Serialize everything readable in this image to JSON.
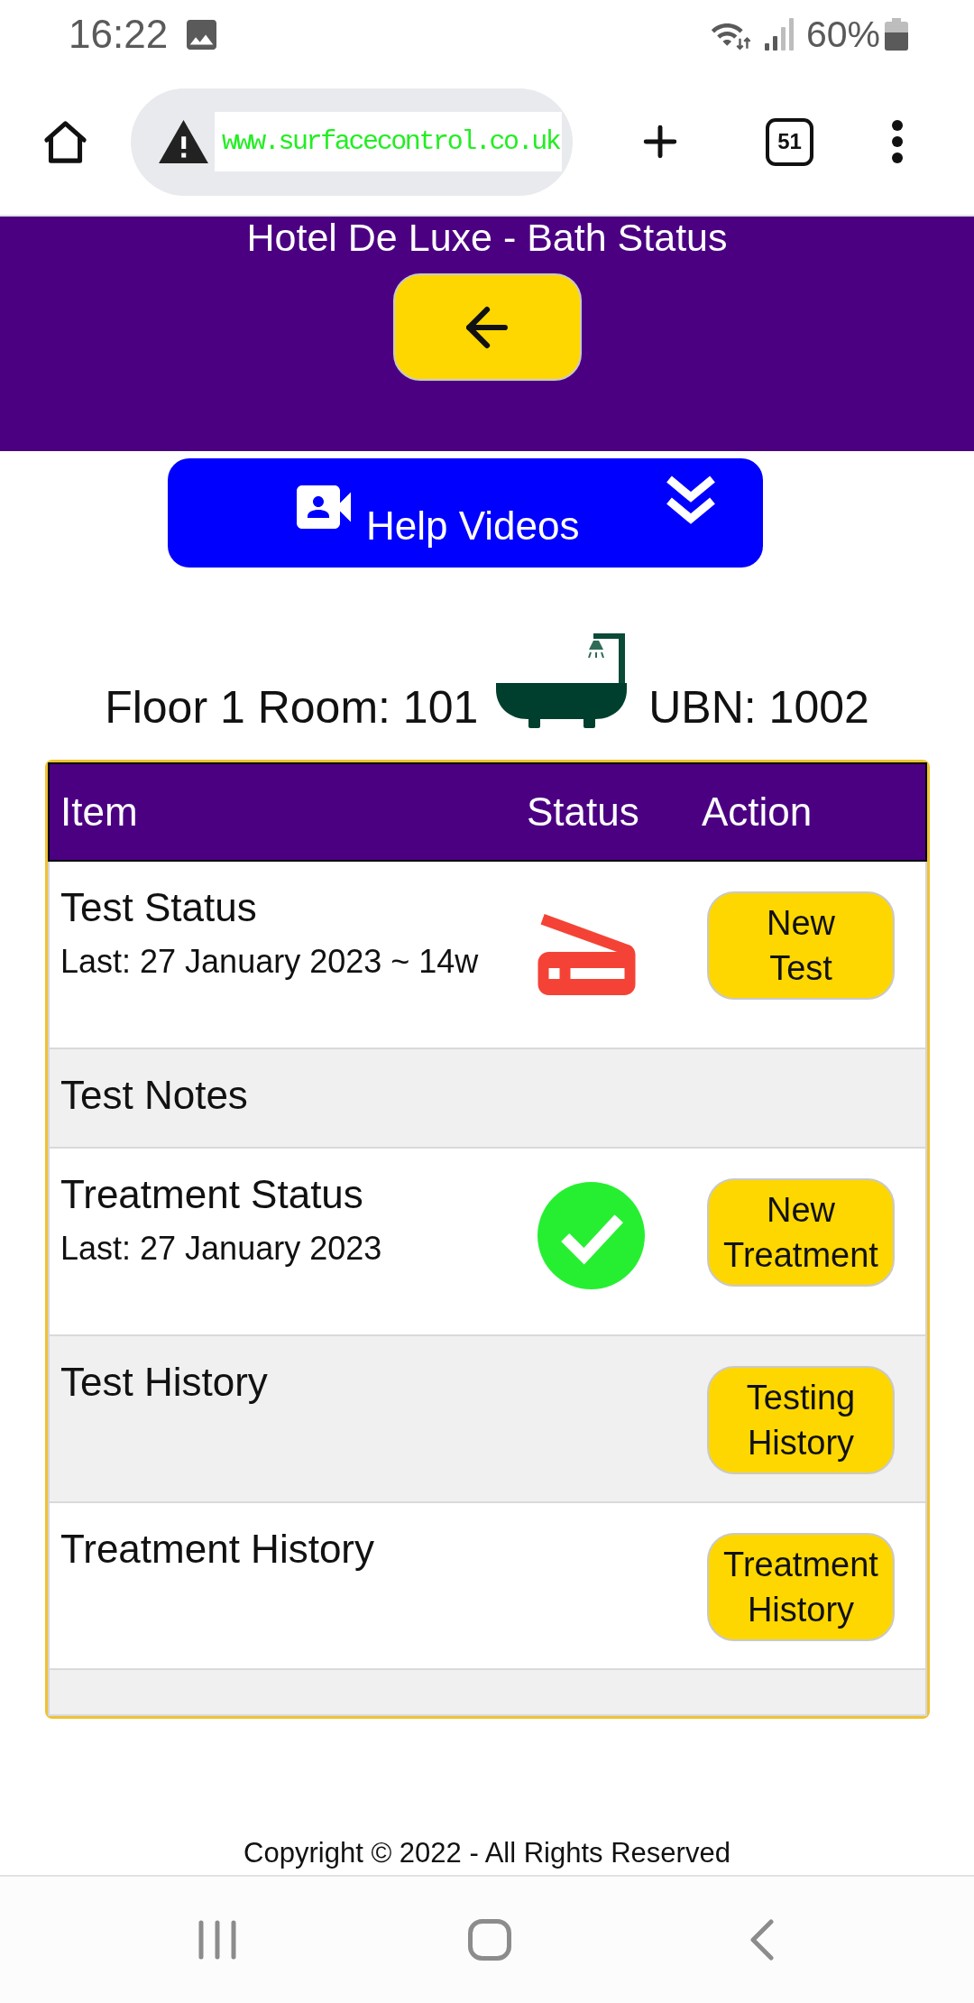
{
  "status_bar": {
    "time": "16:22",
    "battery": "60%"
  },
  "browser": {
    "url": "www.surfacecontrol.co.uk",
    "tab_count": "51"
  },
  "header": {
    "title": "Hotel De Luxe - Bath Status"
  },
  "help_videos": {
    "label": "Help Videos"
  },
  "room": {
    "location": "Floor 1 Room: 101",
    "unit": "UBN: 1002"
  },
  "table": {
    "columns": [
      "Item",
      "Status",
      "Action"
    ],
    "rows": [
      {
        "title": "Test Status",
        "detail": "Last: 27 January 2023 ~ 14w",
        "kind": "status",
        "passed": false,
        "action": "New\nTest"
      },
      {
        "title": "Test Notes",
        "kind": "plain"
      },
      {
        "title": "Treatment Status",
        "detail": "Last: 27 January 2023",
        "kind": "status",
        "passed": true,
        "action": "New Treatment"
      },
      {
        "title": "Test History",
        "kind": "plain",
        "action": "Testing History"
      },
      {
        "title": "Treatment History",
        "kind": "plain",
        "action": "Treatment History"
      }
    ]
  },
  "footer": {
    "copyright": "Copyright © 2022 - All Rights Reserved"
  }
}
